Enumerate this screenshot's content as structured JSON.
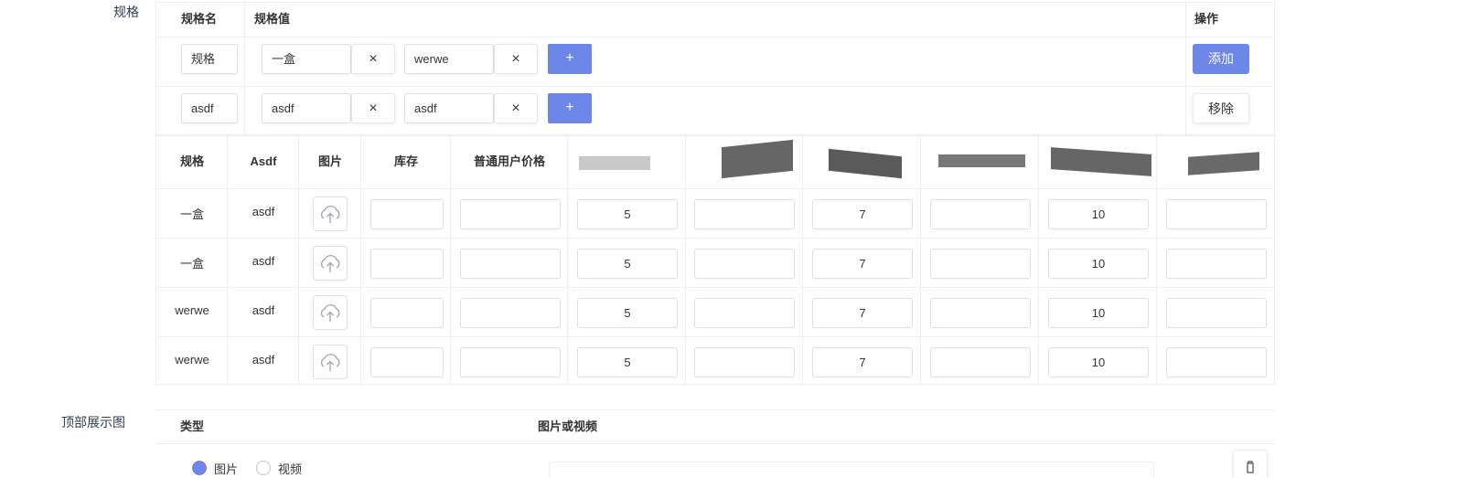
{
  "labels": {
    "spec": "规格",
    "top_display": "顶部展示图"
  },
  "spec_table": {
    "headers": {
      "name": "规格名",
      "value": "规格值",
      "op": "操作"
    },
    "rows": [
      {
        "name": "规格",
        "values": [
          "一盒",
          "werwe"
        ],
        "action": "添加"
      },
      {
        "name": "asdf",
        "values": [
          "asdf",
          "asdf"
        ],
        "action": "移除"
      }
    ],
    "remove_glyph": "×",
    "add_glyph": "+"
  },
  "sku_table": {
    "headers": [
      "规格",
      "Asdf",
      "图片",
      "库存",
      "普通用户价格"
    ],
    "rows": [
      {
        "spec": "一盒",
        "asdf": "asdf",
        "v1": "5",
        "v2": "7",
        "v3": "10"
      },
      {
        "spec": "一盒",
        "asdf": "asdf",
        "v1": "5",
        "v2": "7",
        "v3": "10"
      },
      {
        "spec": "werwe",
        "asdf": "asdf",
        "v1": "5",
        "v2": "7",
        "v3": "10"
      },
      {
        "spec": "werwe",
        "asdf": "asdf",
        "v1": "5",
        "v2": "7",
        "v3": "10"
      }
    ]
  },
  "media": {
    "headers": {
      "type": "类型",
      "media": "图片或视频"
    },
    "options": [
      "图片",
      "视频"
    ]
  },
  "colors": {
    "accent": "#6c87e8",
    "border": "#ebeef5"
  },
  "icons": [
    "close-icon",
    "plus-icon",
    "upload-cloud-icon",
    "trash-icon"
  ]
}
